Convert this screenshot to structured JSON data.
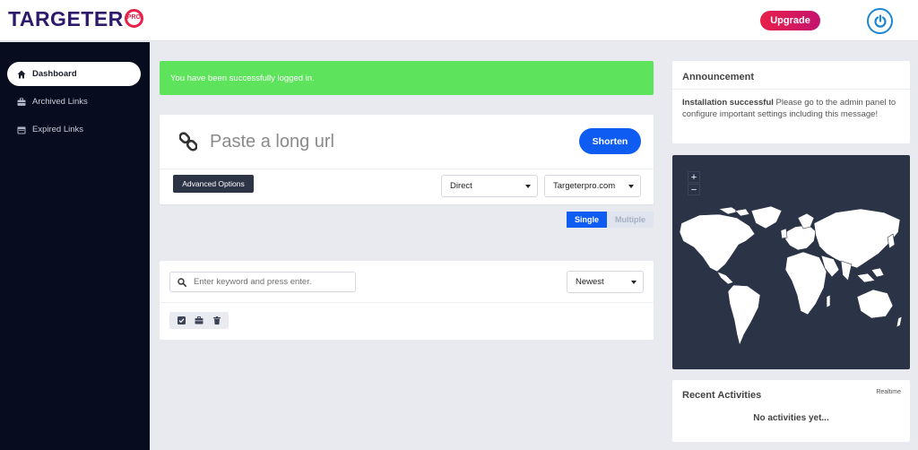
{
  "brand": {
    "name": "TARGETER",
    "badge_text": "PRO"
  },
  "header": {
    "upgrade_label": "Upgrade",
    "power_icon": "power-icon"
  },
  "sidebar": {
    "items": [
      {
        "label": "Dashboard",
        "icon": "home-icon",
        "active": true
      },
      {
        "label": "Archived Links",
        "icon": "briefcase-icon",
        "active": false
      },
      {
        "label": "Expired Links",
        "icon": "calendar-icon",
        "active": false
      }
    ]
  },
  "alert": {
    "message": "You have been successfully logged in."
  },
  "shortener": {
    "placeholder": "Paste a long url",
    "shorten_label": "Shorten",
    "advanced_label": "Advanced Options",
    "redirect_type": "Direct",
    "domain": "Targeterpro.com",
    "toggle_single": "Single",
    "toggle_multiple": "Multiple"
  },
  "links": {
    "search_placeholder": "Enter keyword and press enter.",
    "sort_value": "Newest"
  },
  "announcement": {
    "title": "Announcement",
    "strong": "Installation successful",
    "body": " Please go to the admin panel to configure important settings including this message!"
  },
  "map": {
    "zoom_in": "+",
    "zoom_out": "−"
  },
  "activities": {
    "title": "Recent Activities",
    "tag": "Realtime",
    "empty": "No activities yet..."
  },
  "colors": {
    "accent": "#0f5cf2",
    "success": "#5ee35d",
    "sidebar_bg": "#070d1f",
    "map_bg": "#2b3446",
    "brand_red": "#e8204a"
  }
}
